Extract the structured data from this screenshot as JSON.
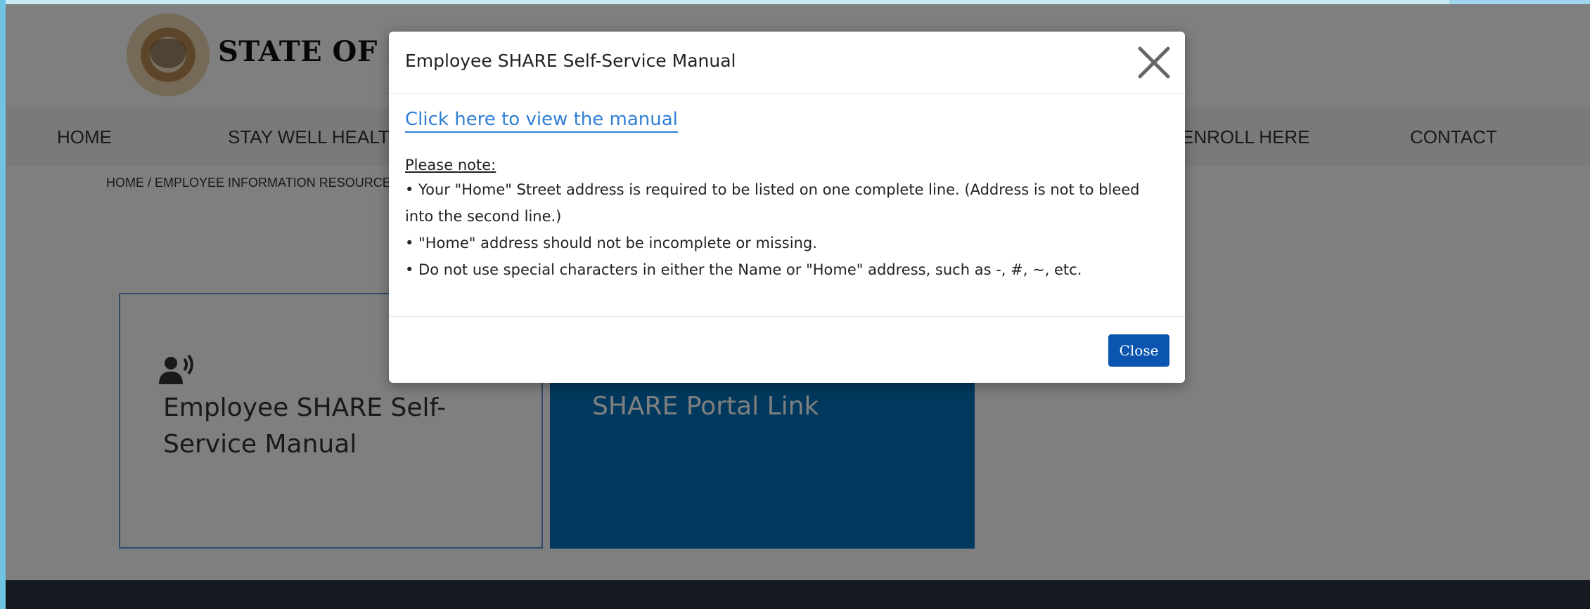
{
  "header": {
    "title": "STATE OF N"
  },
  "nav": {
    "items": [
      {
        "label": "HOME"
      },
      {
        "label": "STAY WELL HEALTH"
      },
      {
        "label": "ENROLL HERE"
      },
      {
        "label": "CONTACT"
      }
    ]
  },
  "breadcrumb": "HOME / EMPLOYEE INFORMATION RESOURCES /",
  "cards": {
    "manual": {
      "label": "Employee SHARE Self-Service Manual",
      "icon": "speaking-person-icon"
    },
    "portal": {
      "label": "SHARE Portal Link",
      "icon": "document-icon"
    }
  },
  "modal": {
    "title": "Employee SHARE Self-Service Manual",
    "link_text": "Click here to view the manual",
    "note_heading": "Please note:",
    "notes": [
      "• Your \"Home\" Street address is required to be listed on one complete line. (Address is not to bleed into the second line.)",
      "• \"Home\" address should not be incomplete or missing.",
      "• Do not use special characters in either the Name or \"Home\" address, such as -, #, ~, etc."
    ],
    "close_label": "Close"
  },
  "colors": {
    "portal_card": "#0073bb",
    "link": "#2f7fd6",
    "close_button": "#0b55b0"
  }
}
